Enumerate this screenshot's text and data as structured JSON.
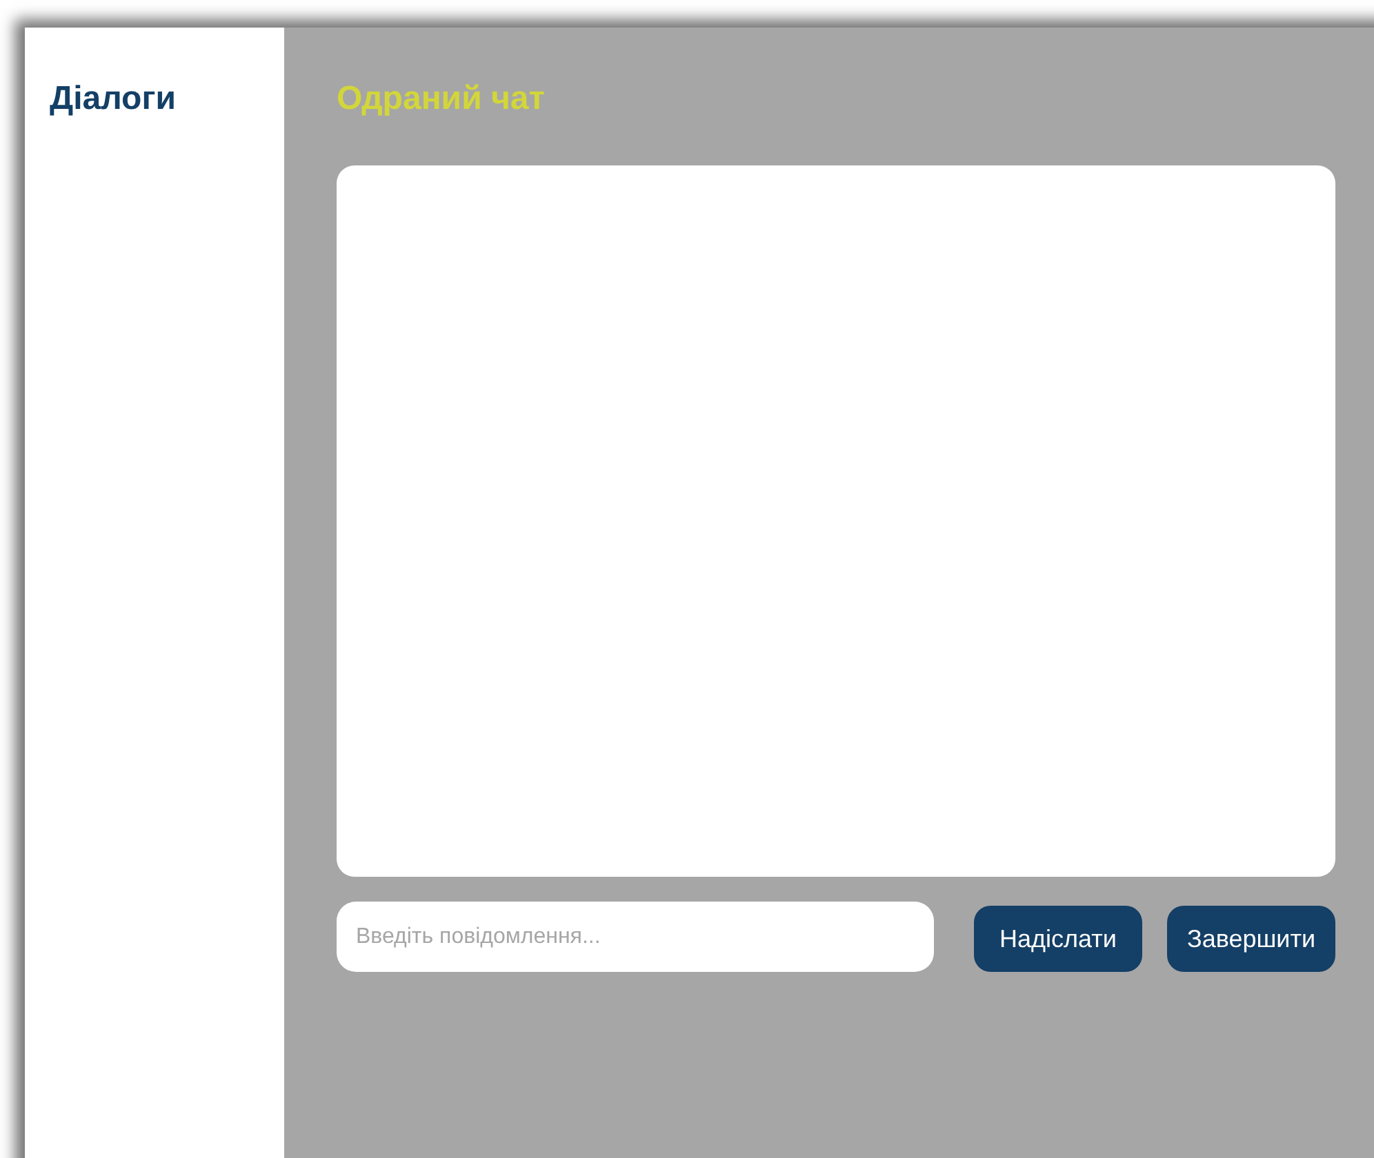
{
  "sidebar": {
    "title": "Діалоги"
  },
  "chat": {
    "title": "Одраний чат",
    "input": {
      "placeholder": "Введіть повідомлення..."
    },
    "buttons": [
      {
        "label": "Надіслати"
      },
      {
        "label": "Завершити"
      }
    ]
  }
}
